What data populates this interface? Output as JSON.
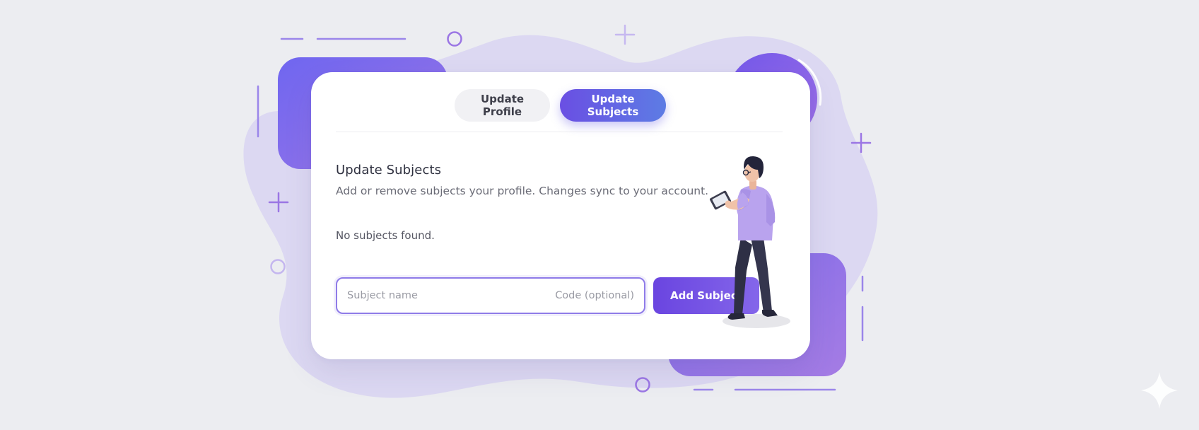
{
  "tabs": {
    "update_profile": "Update Profile",
    "update_subjects": "Update Subjects",
    "active": "update_subjects"
  },
  "section": {
    "title": "Update Subjects",
    "description": "Add or remove subjects your profile. Changes sync to your account.",
    "empty_message": "No subjects found."
  },
  "form": {
    "subject_name_placeholder": "Subject name",
    "code_placeholder": "Code (optional)",
    "subject_name_value": "",
    "code_value": "",
    "add_button_label": "Add Subject"
  },
  "colors": {
    "accent_primary": "#6a4fe3",
    "accent_secondary": "#5d7ce4",
    "button_gradient_start": "#6a45e0",
    "button_gradient_end": "#8466ea",
    "input_focus_border": "#8f7be8",
    "background": "#ecedf1",
    "card": "#ffffff",
    "illustration_shirt": "#b9a3ee",
    "illustration_pants": "#2e2f45"
  },
  "icons": {
    "illustration": "person-with-tablet-illustration",
    "decor": [
      "circle-outline-icon",
      "plus-icon",
      "sparkle-icon"
    ]
  }
}
